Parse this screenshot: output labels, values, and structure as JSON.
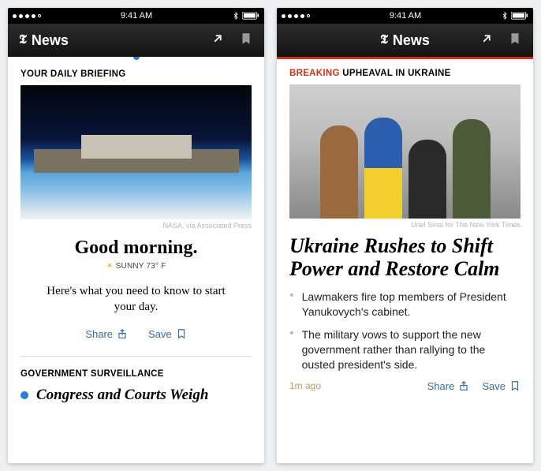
{
  "status": {
    "time": "9:41 AM"
  },
  "nav": {
    "title": "News"
  },
  "left": {
    "kicker": "YOUR DAILY BRIEFING",
    "hero_credit": "NASA, via Associated Press",
    "greeting": "Good morning.",
    "weather": "SUNNY 73° F",
    "intro": "Here's what you need to know to start your day.",
    "share": "Share",
    "save": "Save",
    "section2": "GOVERNMENT SURVEILLANCE",
    "story2": "Congress and Courts Weigh"
  },
  "right": {
    "breaking": "BREAKING",
    "breaking_rest": " UPHEAVAL IN UKRAINE",
    "hero_credit": "Uriel Sinai for The New York Times",
    "headline": "Ukraine Rushes to Shift Power and Restore Calm",
    "bullet1": "Lawmakers fire top members of President Yanukovych's cabinet.",
    "bullet2": "The military vows to support the new government rather than rallying to the ousted president's side.",
    "timeago": "1m ago",
    "share": "Share",
    "save": "Save"
  }
}
